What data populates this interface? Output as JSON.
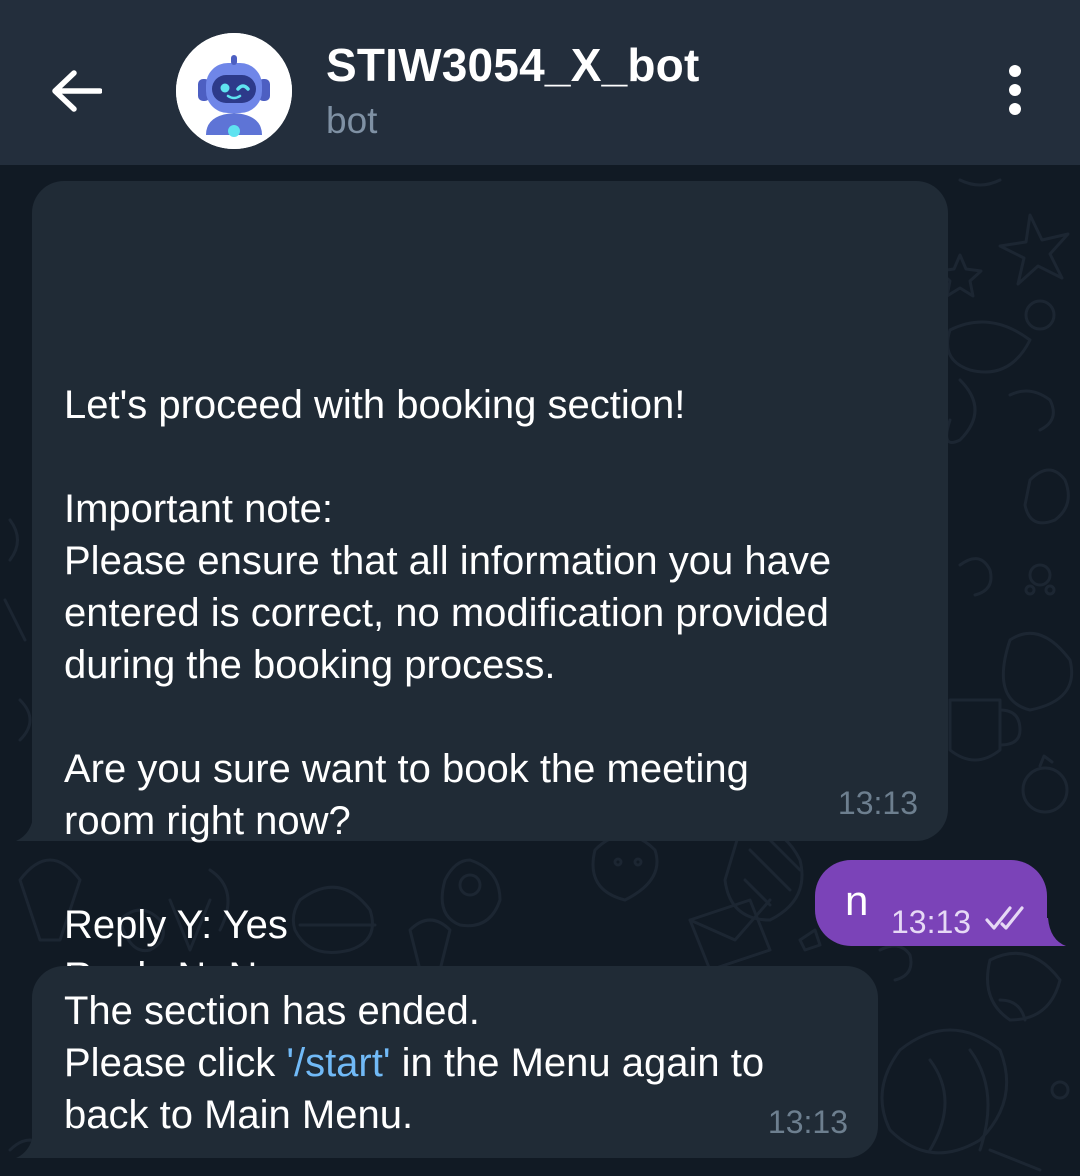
{
  "header": {
    "back_icon": "arrow-left-icon",
    "avatar_icon": "robot-avatar-icon",
    "title": "STIW3054_X_bot",
    "subtitle": "bot",
    "menu_icon": "more-vertical-icon"
  },
  "messages": [
    {
      "direction": "incoming",
      "lines": [
        "Let's proceed with booking section!",
        "",
        "Important note:",
        "Please ensure that all information you have",
        "entered is correct, no modification provided",
        "during the booking process.",
        "",
        "Are you sure want to book the meeting",
        "room right now?",
        "",
        "Reply Y: Yes",
        "Reply N: No"
      ],
      "time": "13:13"
    },
    {
      "direction": "outgoing",
      "text": "n",
      "time": "13:13",
      "status_icon": "double-check-icon"
    },
    {
      "direction": "incoming",
      "line1": "The section has ended.",
      "line2_before": "Please click ",
      "line2_link": "'/start'",
      "line2_after": " in the Menu again to",
      "line3": "back to Main Menu.",
      "time": "13:13"
    }
  ],
  "colors": {
    "header_bg": "#232e3c",
    "chat_bg": "#111a24",
    "incoming_bubble": "#202b36",
    "outgoing_bubble": "#7b43b8",
    "link": "#71baf7"
  }
}
